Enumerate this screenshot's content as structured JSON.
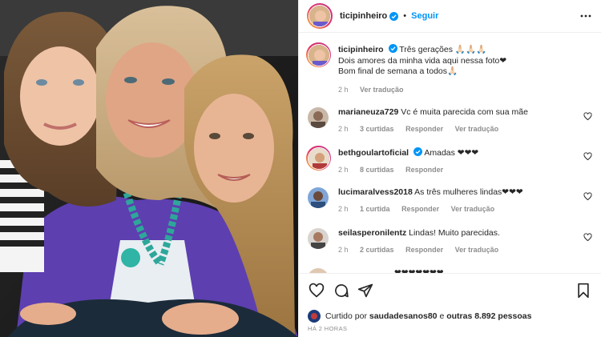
{
  "post": {
    "author": "ticipinheiro",
    "follow_label": "Seguir",
    "dot": "•"
  },
  "caption": {
    "author": "ticipinheiro",
    "line1": "Três gerações 🙏🏻🙏🏻🙏🏻",
    "line2": "Dois amores da minha vida aqui nessa foto❤",
    "line3": "Bom final de semana a todos🙏🏻",
    "time": "2 h",
    "translate": "Ver tradução"
  },
  "comments": [
    {
      "user": "marianeuza729",
      "text": "Vc é muita parecida com sua mãe",
      "time": "2 h",
      "likes": "3 curtidas",
      "reply": "Responder",
      "translate": "Ver tradução",
      "verified": false,
      "story": false
    },
    {
      "user": "bethgoulartoficial",
      "text": "Amadas ❤❤❤",
      "time": "2 h",
      "likes": "8 curtidas",
      "reply": "Responder",
      "translate": "",
      "verified": true,
      "story": true
    },
    {
      "user": "lucimaralvess2018",
      "text": "As três mulheres lindas❤❤❤",
      "time": "2 h",
      "likes": "1 curtida",
      "reply": "Responder",
      "translate": "Ver tradução",
      "verified": false,
      "story": false
    },
    {
      "user": "seilasperonilentz",
      "text": "Lindas! Muito parecidas.",
      "time": "2 h",
      "likes": "2 curtidas",
      "reply": "Responder",
      "translate": "Ver tradução",
      "verified": false,
      "story": false
    }
  ],
  "partial_comment": "❤❤❤❤❤❤❤",
  "likes": {
    "prefix": "Curtido por",
    "user": "saudadesanos80",
    "conj": "e",
    "others": "outras 8.892 pessoas"
  },
  "timestamp": "HÁ 2 HORAS",
  "icons": {
    "verified": "verified-badge-icon",
    "more": "more-options-icon",
    "like": "heart-icon",
    "comment": "comment-icon",
    "share": "share-icon",
    "save": "bookmark-icon"
  },
  "colors": {
    "link": "#0095f6",
    "verified": "#0095f6",
    "muted": "#8e8e8e"
  }
}
